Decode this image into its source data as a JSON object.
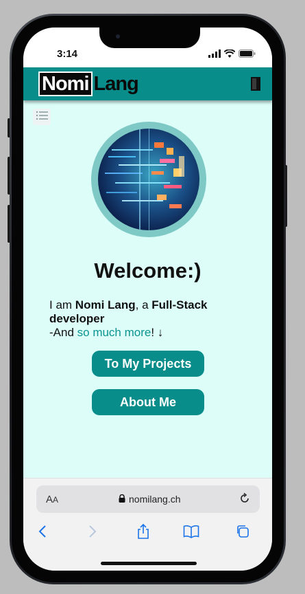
{
  "status": {
    "time": "3:14"
  },
  "header": {
    "logo_part1": "Nomi",
    "logo_part2": "Lang"
  },
  "main": {
    "welcome": "Welcome:)",
    "intro": {
      "prefix": "I am ",
      "name": "Nomi Lang",
      "middle": ", a ",
      "role": "Full-Stack developer",
      "line2_prefix": "-And ",
      "highlight": "so much more",
      "suffix": "! ↓"
    },
    "buttons": {
      "projects": "To My Projects",
      "about": "About Me"
    }
  },
  "browser": {
    "text_size": "A",
    "text_size_small": "A",
    "url": "nomilang.ch"
  },
  "colors": {
    "accent": "#098d8a",
    "background": "#dcfdf8",
    "avatar_ring": "#7ec9c6"
  },
  "icons": [
    "signal-icon",
    "wifi-icon",
    "battery-icon",
    "door-icon",
    "menu-icon",
    "lock-icon",
    "reload-icon",
    "back-icon",
    "forward-icon",
    "share-icon",
    "bookmarks-icon",
    "tabs-icon"
  ]
}
